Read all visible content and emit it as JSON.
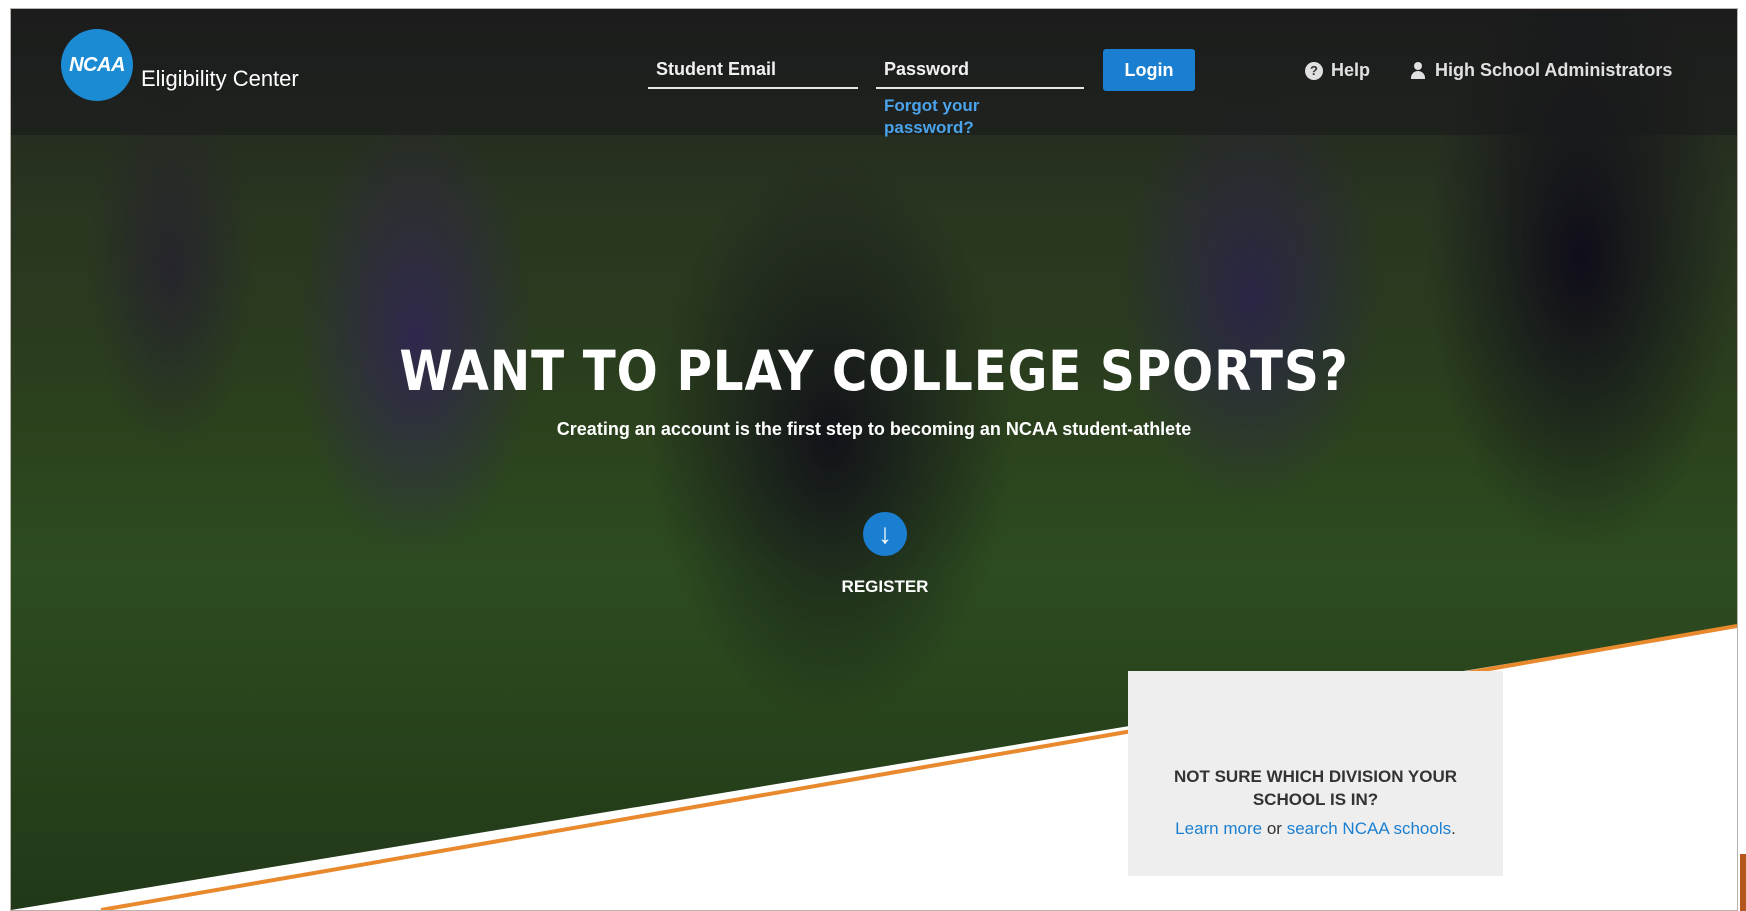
{
  "brand": {
    "logo_text": "NCAA",
    "name": "Eligibility Center"
  },
  "login": {
    "email_placeholder": "Student Email",
    "password_placeholder": "Password",
    "button": "Login",
    "forgot": "Forgot your password?"
  },
  "nav": {
    "help": "Help",
    "admins": "High School Administrators"
  },
  "hero": {
    "headline": "WANT TO PLAY COLLEGE SPORTS?",
    "subline": "Creating an account is the first step to becoming an NCAA student-athlete",
    "register": "REGISTER"
  },
  "division": {
    "title": "NOT SURE WHICH DIVISION YOUR SCHOOL IS IN?",
    "learn_more": "Learn more",
    "or": "or",
    "search": "search NCAA schools",
    "period": "."
  },
  "colors": {
    "accent_blue": "#1b7fd1",
    "logo_blue": "#1b8bd3",
    "stripe_orange": "#e8892e"
  }
}
